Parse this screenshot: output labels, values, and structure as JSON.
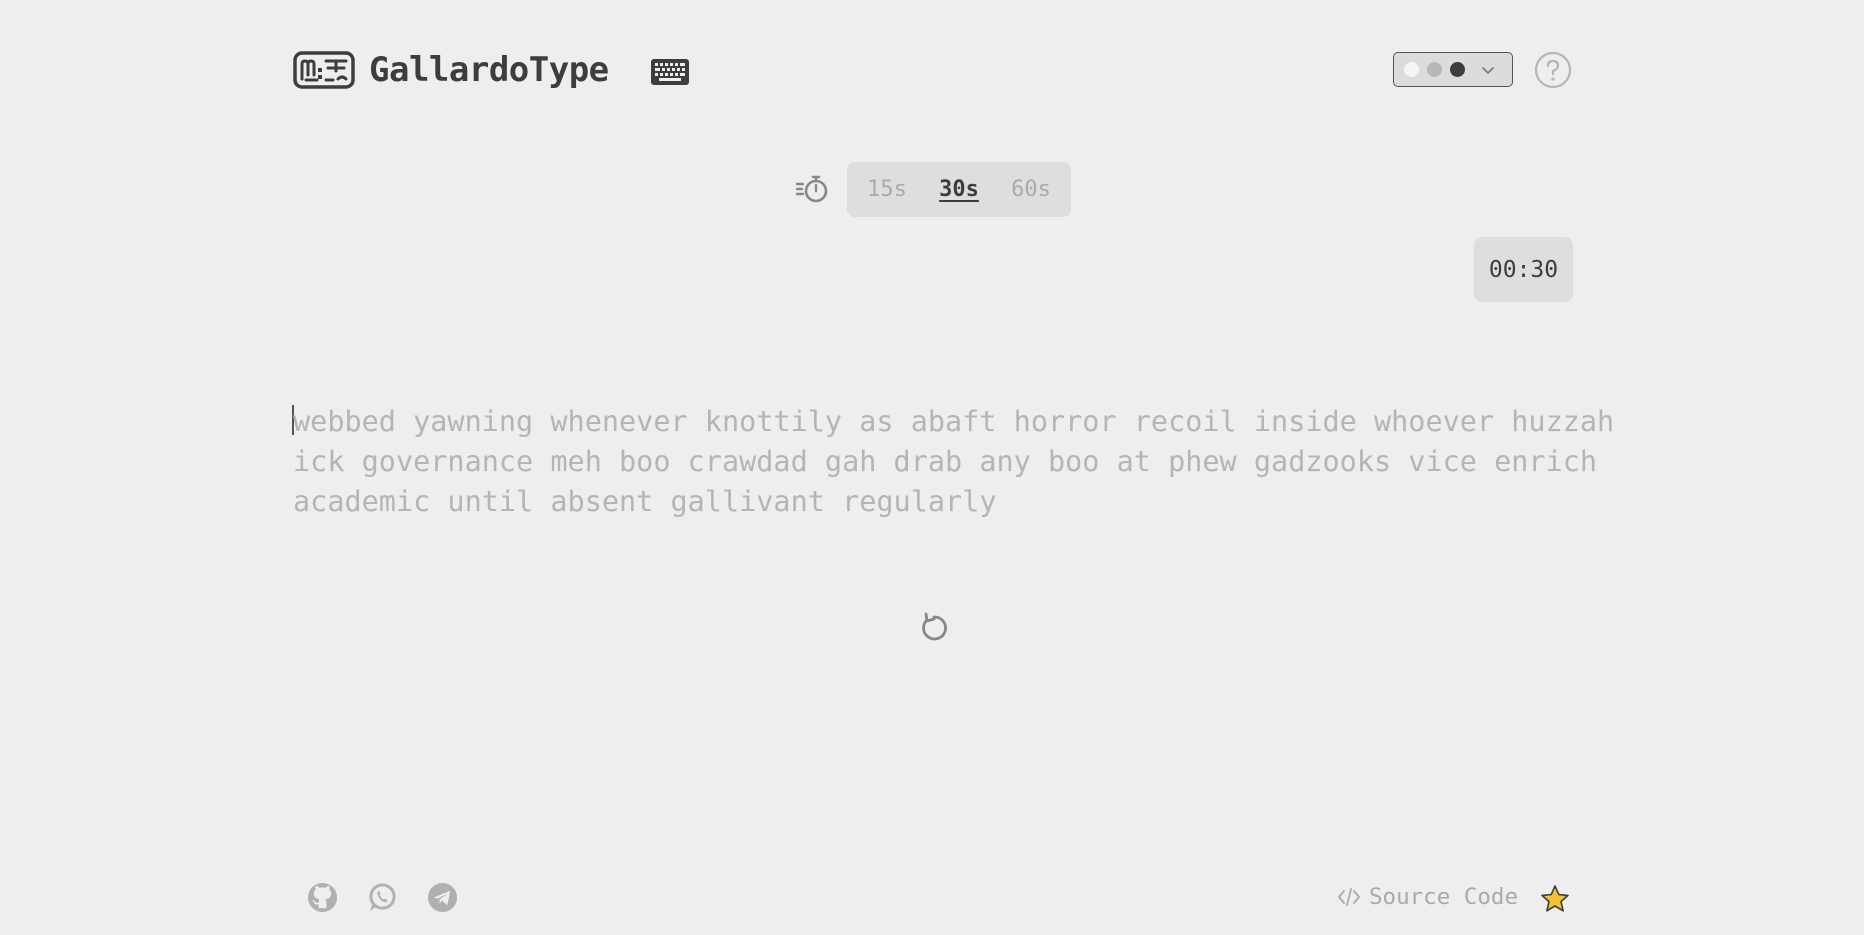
{
  "header": {
    "title": "GallardoType",
    "logo_icon": "mt-logo-icon",
    "keyboard_icon": "keyboard-icon",
    "help_icon": "help-circle-icon"
  },
  "theme_selector": {
    "swatches": [
      "#f5f5f5",
      "#b8b8b8",
      "#3d3d3d"
    ],
    "chevron_icon": "chevron-down-icon"
  },
  "time_selector": {
    "icon": "timer-icon",
    "options": [
      {
        "label": "15s",
        "active": false
      },
      {
        "label": "30s",
        "active": true
      },
      {
        "label": "60s",
        "active": false
      }
    ]
  },
  "countdown": {
    "value": "00:30"
  },
  "words": {
    "lines": [
      "webbed yawning whenever knottily as abaft horror recoil inside whoever huzzah",
      "ick governance meh boo crawdad gah drab any boo at phew gadzooks vice enrich",
      "academic until absent gallivant regularly"
    ]
  },
  "restart": {
    "icon": "restart-icon"
  },
  "footer": {
    "social_icons": [
      "github-icon",
      "whatsapp-icon",
      "telegram-icon"
    ],
    "source_code_label": "Source Code",
    "source_code_icon": "code-icon",
    "star_icon": "star-icon"
  },
  "colors": {
    "background": "#eeeeee",
    "text_primary": "#3d3d3d",
    "text_muted": "#b5b5b5",
    "panel": "#dedede",
    "star": "#f2c230"
  }
}
